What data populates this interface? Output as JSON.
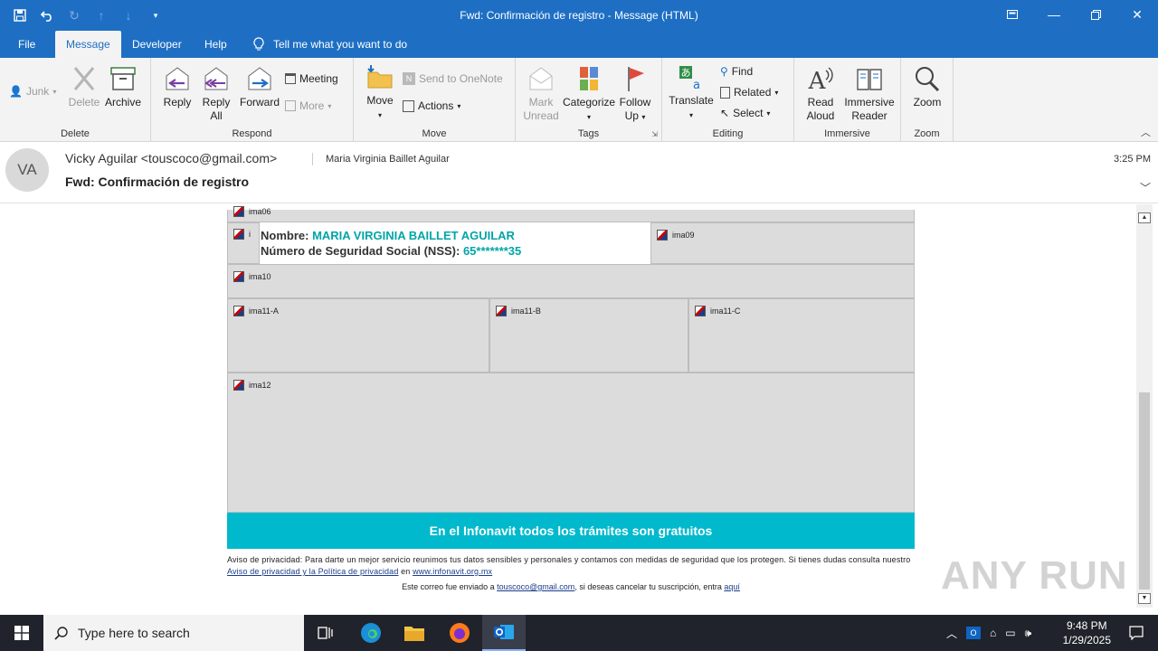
{
  "window": {
    "title": "Fwd: Confirmación de registro  -  Message (HTML)"
  },
  "tabs": [
    {
      "label": "File"
    },
    {
      "label": "Message"
    },
    {
      "label": "Developer"
    },
    {
      "label": "Help"
    }
  ],
  "tell_me": "Tell me what you want to do",
  "ribbon": {
    "delete_group": {
      "label": "Delete",
      "junk": "Junk",
      "delete": "Delete",
      "archive": "Archive"
    },
    "respond_group": {
      "label": "Respond",
      "reply": "Reply",
      "reply_all_1": "Reply",
      "reply_all_2": "All",
      "forward": "Forward",
      "meeting": "Meeting",
      "more": "More"
    },
    "move_group": {
      "label": "Move",
      "move": "Move",
      "send_onenote": "Send to OneNote",
      "actions": "Actions"
    },
    "tags_group": {
      "label": "Tags",
      "mark_unread_1": "Mark",
      "mark_unread_2": "Unread",
      "categorize": "Categorize",
      "follow_up_1": "Follow",
      "follow_up_2": "Up"
    },
    "editing_group": {
      "label": "Editing",
      "translate": "Translate",
      "find": "Find",
      "related": "Related",
      "select": "Select"
    },
    "immersive_group": {
      "label": "Immersive",
      "read_aloud_1": "Read",
      "read_aloud_2": "Aloud",
      "immersive_reader_1": "Immersive",
      "immersive_reader_2": "Reader"
    },
    "zoom_group": {
      "label": "Zoom",
      "zoom": "Zoom"
    }
  },
  "message": {
    "avatar_initials": "VA",
    "from": "Vicky Aguilar <touscoco@gmail.com>",
    "to": "Maria Virginia Baillet Aguilar",
    "subject": "Fwd: Confirmación de registro",
    "time": "3:25 PM"
  },
  "email_body": {
    "img_top": "ima06",
    "img_left_fragment": "i",
    "nombre_label": "Nombre: ",
    "nombre_value": "MARIA VIRGINIA BAILLET AGUILAR",
    "nss_label": "Número de Seguridad Social (NSS): ",
    "nss_value": "65*******35",
    "img_09": "ima09",
    "img_10": "ima10",
    "img_11a": "ima11-A",
    "img_11b": "ima11-B",
    "img_11c": "ima11-C",
    "img_12": "ima12",
    "banner": "En el Infonavit todos los trámites son gratuitos",
    "privacy_text_1": "Aviso de privacidad: Para darte un mejor servicio reunimos tus datos sensibles y personales y contamos con medidas de seguridad que los protegen. Si tienes dudas consulta nuestro ",
    "privacy_link": "Aviso de privacidad y la Política de privacidad",
    "privacy_text_2": " en ",
    "privacy_site": "www.infonavit.org.mx",
    "footer_text_1": "Este correo fue enviado a ",
    "footer_email": "touscoco@gmail.com",
    "footer_text_2": ", si deseas cancelar tu suscripción, entra ",
    "footer_link": "aquí"
  },
  "watermark": "ANY RUN",
  "taskbar": {
    "search_placeholder": "Type here to search",
    "time": "9:48 PM",
    "date": "1/29/2025"
  },
  "colors": {
    "title_blue": "#1e6fc4",
    "teal": "#00b9cc",
    "name_teal": "#00a5a8"
  }
}
